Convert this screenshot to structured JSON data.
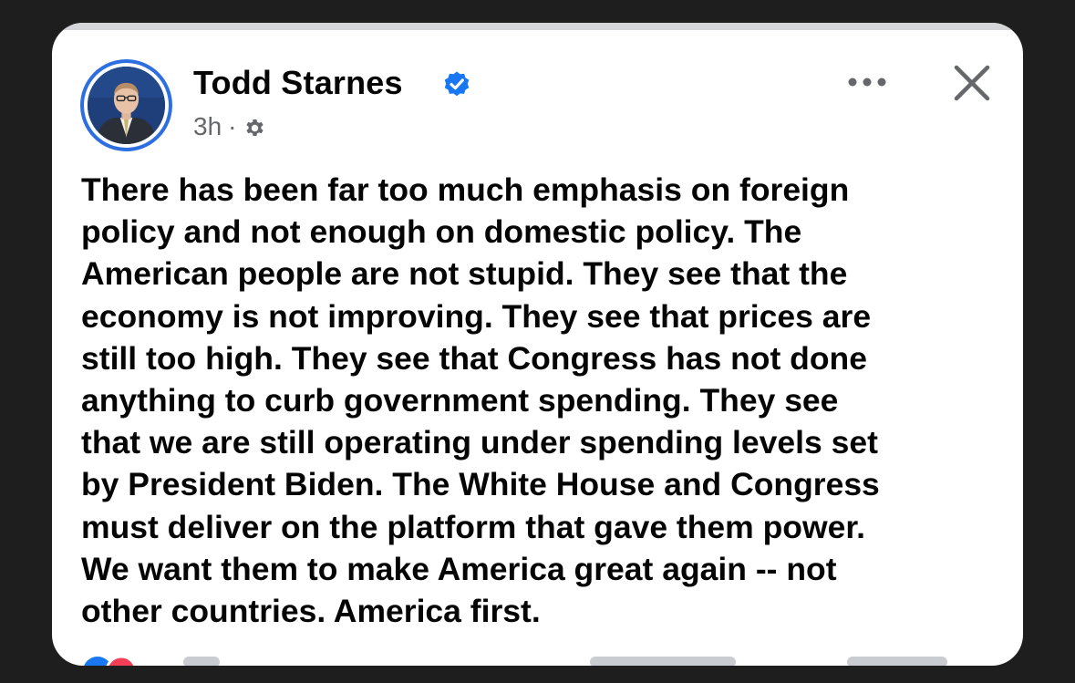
{
  "post": {
    "author": "Todd Starnes",
    "timestamp": "3h",
    "separator": "·",
    "audience_icon": "gear-icon",
    "verified_icon": "verified-badge-icon",
    "body": "There has been far too much emphasis on foreign\npolicy and not enough on domestic policy. The\nAmerican people are not stupid. They see that the\neconomy is not improving. They see that prices are\nstill too high. They see that Congress has not done\nanything to curb government spending. They see\nthat we are still operating under spending levels set\nby President Biden. The White House and Congress\nmust deliver on the platform that gave them power.\nWe want them to make America great again -- not\nother countries. America first."
  },
  "header_actions": {
    "more_icon": "more-horizontal-icon",
    "close_icon": "close-icon"
  },
  "footer": {
    "reaction_icons": [
      "like-icon",
      "love-icon"
    ]
  },
  "colors": {
    "page_background": "#1e1e1e",
    "card_background": "#ffffff",
    "text_primary": "#050505",
    "text_secondary": "#65676b",
    "verified_blue": "#1877f2",
    "avatar_ring": "#2d6fe0"
  }
}
